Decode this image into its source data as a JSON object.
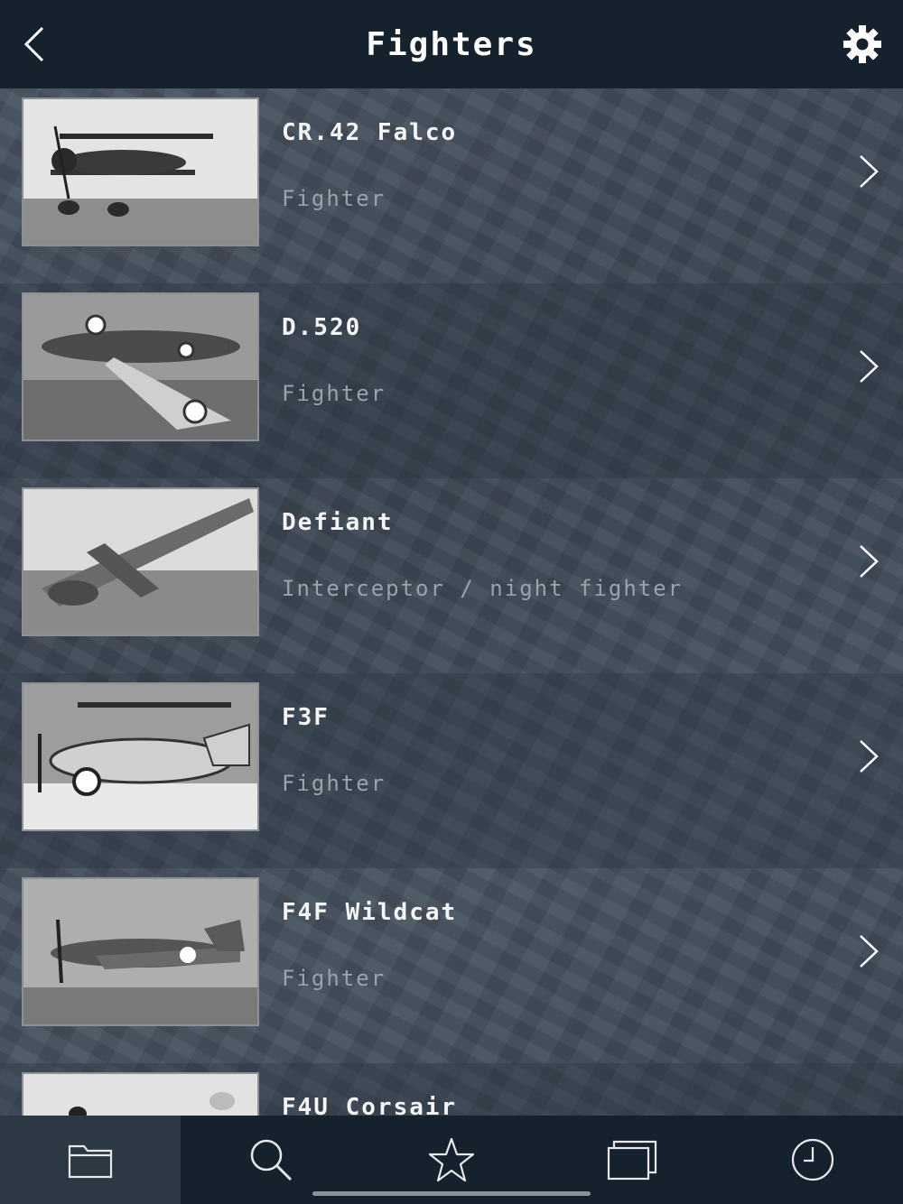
{
  "header": {
    "title": "Fighters",
    "back_icon": "chevron-left-icon",
    "settings_icon": "gear-icon"
  },
  "items": [
    {
      "name": "CR.42 Falco",
      "role": "Fighter"
    },
    {
      "name": "D.520",
      "role": "Fighter"
    },
    {
      "name": "Defiant",
      "role": "Interceptor / night fighter"
    },
    {
      "name": "F3F",
      "role": "Fighter"
    },
    {
      "name": "F4F Wildcat",
      "role": "Fighter"
    },
    {
      "name": "F4U Corsair",
      "role": ""
    }
  ],
  "tabs": [
    {
      "icon": "folder-icon",
      "active": true
    },
    {
      "icon": "search-icon",
      "active": false
    },
    {
      "icon": "star-icon",
      "active": false
    },
    {
      "icon": "windows-icon",
      "active": false
    },
    {
      "icon": "clock-icon",
      "active": false
    }
  ],
  "colors": {
    "bar_background": "#15222d",
    "active_tab": "#2c3945",
    "subtitle": "#9aa2aa"
  }
}
